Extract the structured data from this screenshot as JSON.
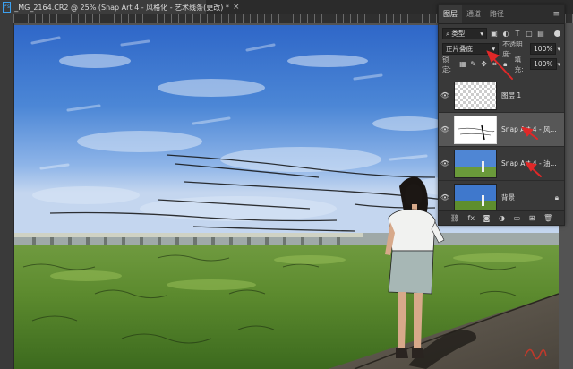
{
  "document": {
    "title": "_MG_2164.CR2 @ 25% (Snap Art 4 - 风格化 - 艺术线条(更改) *",
    "app_badge": "Ps",
    "close_glyph": "×"
  },
  "layers_panel": {
    "tabs": [
      {
        "label": "图层",
        "active": true
      },
      {
        "label": "通道",
        "active": false
      },
      {
        "label": "路径",
        "active": false
      }
    ],
    "menu_glyph": "≡",
    "filter": {
      "value": "类型"
    },
    "blend_mode": {
      "value": "正片叠底"
    },
    "opacity": {
      "label": "不透明度:",
      "value": "100%"
    },
    "lock": {
      "label": "锁定:"
    },
    "fill": {
      "label": "填充:",
      "value": "100%"
    },
    "layers": [
      {
        "name": "图层 1",
        "visible": true,
        "selected": false,
        "locked": false,
        "thumbnail": "transparent"
      },
      {
        "name": "Snap Art 4 - 风...",
        "visible": true,
        "selected": true,
        "locked": false,
        "thumbnail": "lineart"
      },
      {
        "name": "Snap Art 4 - 油...",
        "visible": true,
        "selected": false,
        "locked": false,
        "thumbnail": "painted"
      },
      {
        "name": "背景",
        "visible": true,
        "selected": false,
        "locked": true,
        "thumbnail": "photo"
      }
    ],
    "footer_icons": [
      "link-icon",
      "fx-icon",
      "mask-icon",
      "adjustment-icon",
      "folder-icon",
      "new-layer-icon",
      "trash-icon"
    ],
    "footer_labels": {
      "fx": "fx"
    }
  },
  "annotation_color": "#e02828"
}
